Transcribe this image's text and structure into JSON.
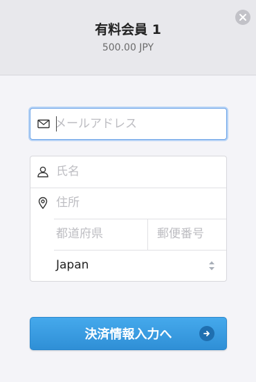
{
  "header": {
    "title": "有料会員 1",
    "price": "500.00 JPY"
  },
  "form": {
    "email": {
      "placeholder": "メールアドレス",
      "value": ""
    },
    "name": {
      "placeholder": "氏名",
      "value": ""
    },
    "address": {
      "placeholder": "住所",
      "value": ""
    },
    "prefecture": {
      "placeholder": "都道府県",
      "value": ""
    },
    "postal_code": {
      "placeholder": "郵便番号",
      "value": ""
    },
    "country": {
      "selected": "Japan"
    }
  },
  "submit": {
    "label": "決済情報入力へ"
  },
  "icons": {
    "close": "close-icon",
    "email": "envelope-icon",
    "name": "person-icon",
    "address": "map-pin-icon",
    "stepper": "up-down-chevron-icon",
    "submit_arrow": "arrow-right-icon"
  },
  "colors": {
    "accent": "#3a9be3",
    "focus_border": "#6aa2e8"
  }
}
